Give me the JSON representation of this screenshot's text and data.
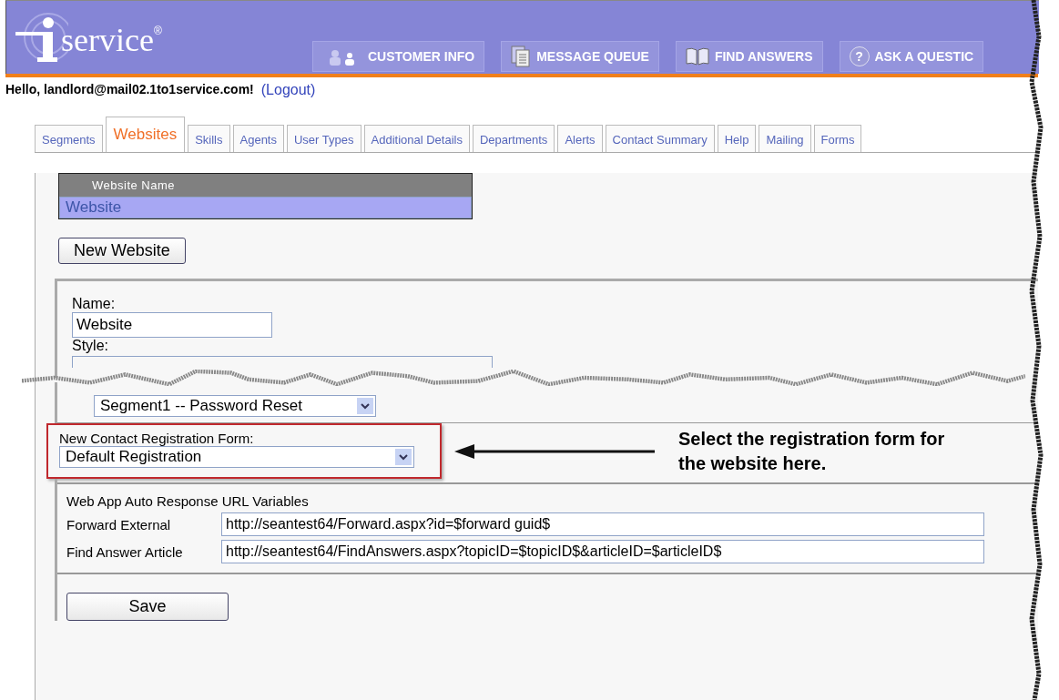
{
  "header": {
    "logo_text": "service",
    "logo_mark": "®",
    "nav": [
      {
        "label": "CUSTOMER INFO",
        "kind": "people"
      },
      {
        "label": "MESSAGE QUEUE",
        "kind": "pages"
      },
      {
        "label": "FIND ANSWERS",
        "kind": "book"
      },
      {
        "label": "ASK A QUESTIC",
        "kind": "question",
        "glyph": "?"
      }
    ]
  },
  "greeting": "Hello, landlord@mail02.1to1service.com!",
  "logout": "(Logout)",
  "tabs": [
    {
      "label": "Segments",
      "selected": false
    },
    {
      "label": "Websites",
      "selected": true
    },
    {
      "label": "Skills",
      "selected": false
    },
    {
      "label": "Agents",
      "selected": false
    },
    {
      "label": "User Types",
      "selected": false
    },
    {
      "label": "Additional Details",
      "selected": false
    },
    {
      "label": "Departments",
      "selected": false
    },
    {
      "label": "Alerts",
      "selected": false
    },
    {
      "label": "Contact Summary",
      "selected": false
    },
    {
      "label": "Help",
      "selected": false
    },
    {
      "label": "Mailing",
      "selected": false
    },
    {
      "label": "Forms",
      "selected": false
    }
  ],
  "table": {
    "columns": [
      "Website Name"
    ],
    "rows": [
      {
        "name": "Website",
        "selected": true
      }
    ]
  },
  "new_button": "New Website",
  "form": {
    "name_label": "Name:",
    "name_value": "Website",
    "style_label": "Style:",
    "segment_value": "Segment1 -- Password Reset",
    "registration_label": "New Contact Registration Form:",
    "registration_value": "Default Registration",
    "callout": "Select the registration form for the website here.",
    "url_section": "Web App Auto Response URL Variables",
    "urls": [
      {
        "label": "Forward External",
        "value": "http://seantest64/Forward.aspx?id=$forward guid$"
      },
      {
        "label": "Find Answer Article",
        "value": "http://seantest64/FindAnswers.aspx?topicID=$topicID$&articleID=$articleID$"
      }
    ],
    "save": "Save"
  }
}
